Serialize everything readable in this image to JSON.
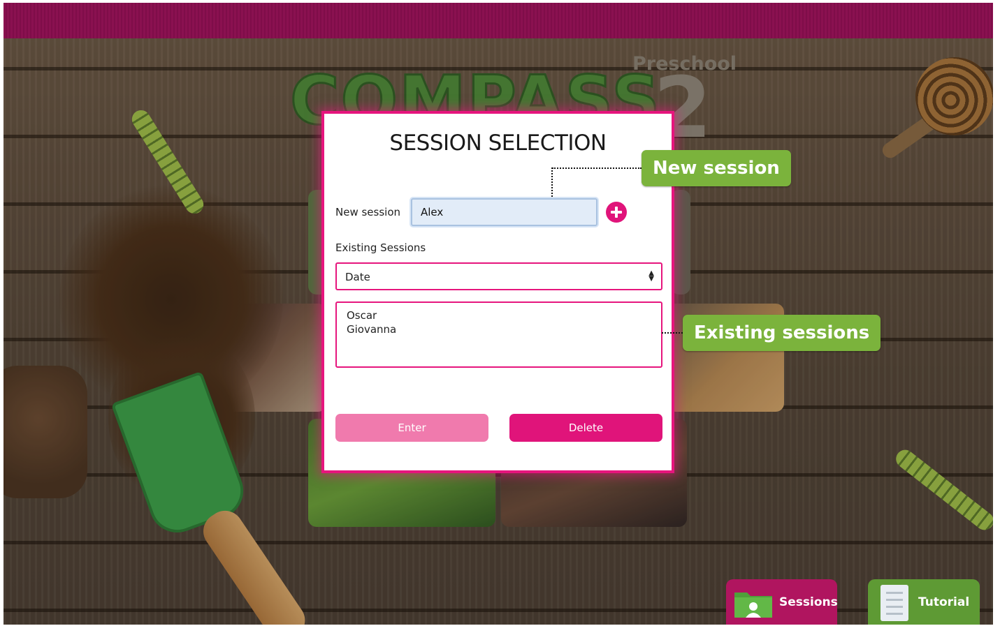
{
  "background": {
    "brand_title": "COMPASS",
    "level_label": "Preschool",
    "level_number": "2"
  },
  "modal": {
    "title": "SESSION SELECTION",
    "new_session_label": "New session",
    "new_session_value": "Alex",
    "add_icon": "plus-circle-icon",
    "existing_sessions_label": "Existing Sessions",
    "sort_select": {
      "selected": "Date"
    },
    "sessions": [
      "Oscar",
      "Giovanna"
    ],
    "enter_label": "Enter",
    "delete_label": "Delete"
  },
  "callouts": {
    "new_session": "New session",
    "existing_sessions": "Existing sessions"
  },
  "bottom_tabs": [
    {
      "label": "Sessions",
      "icon": "folder-user-icon"
    },
    {
      "label": "Tutorial",
      "icon": "list-document-icon"
    }
  ],
  "colors": {
    "accent_pink": "#e6157d",
    "enter_pink": "#f07aad",
    "callout_green": "#7bb33c",
    "top_bar": "#8a1150",
    "tutorial_green": "#5e9a34"
  }
}
